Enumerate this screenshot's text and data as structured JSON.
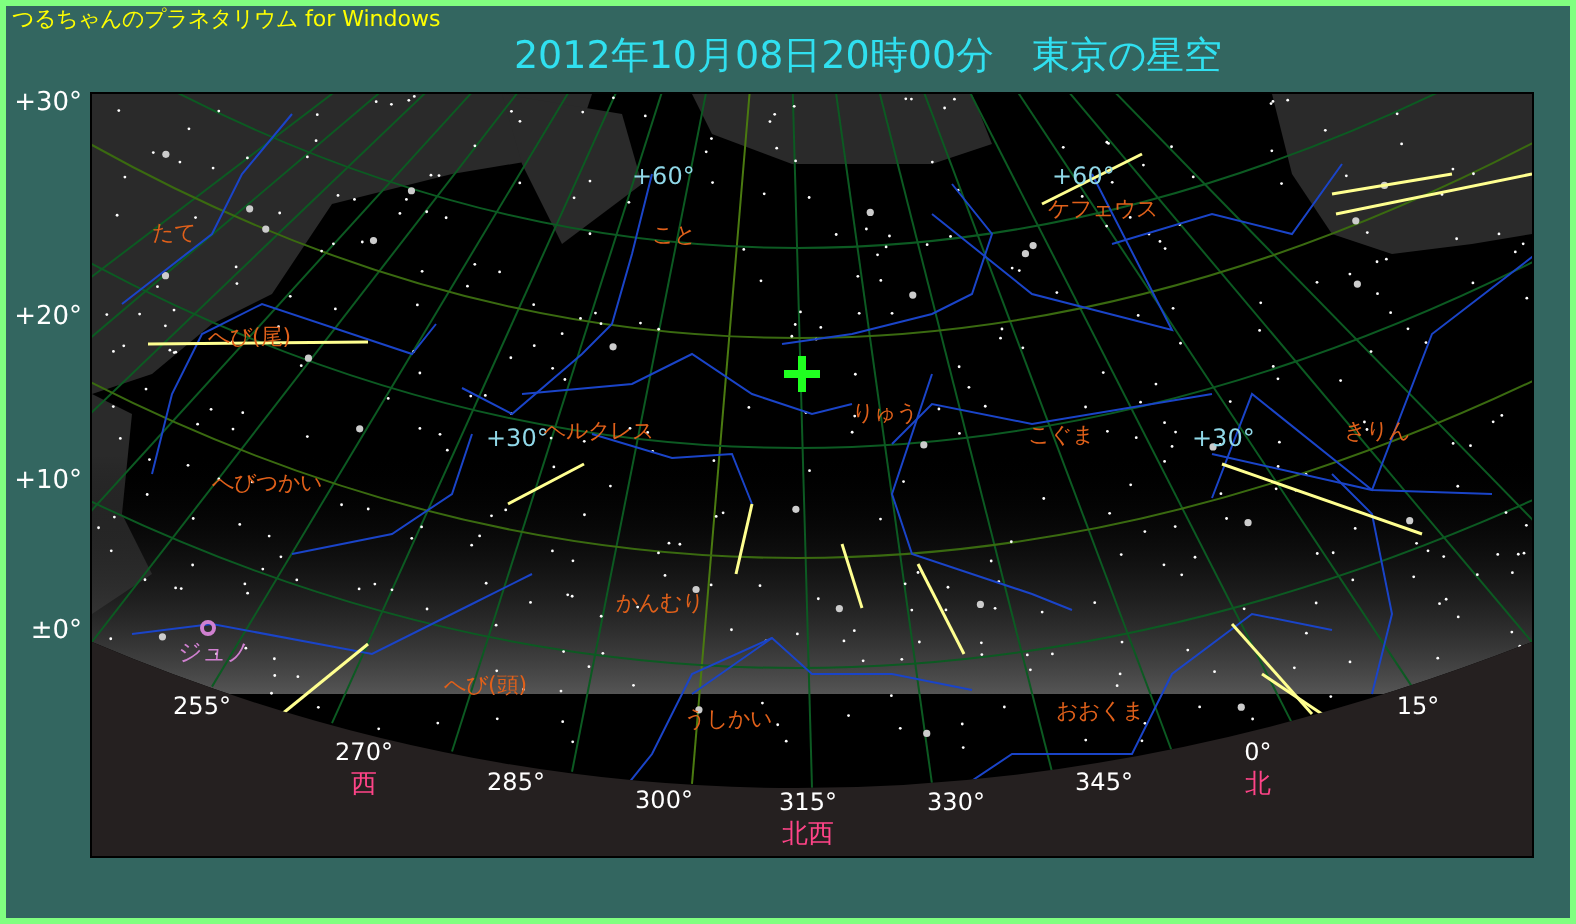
{
  "app_title": "つるちゃんのプラネタリウム for Windows",
  "heading": "2012年10月08日20時00分　東京の星空",
  "altitude_labels": [
    "+30°",
    "+20°",
    "+10°",
    "±0°"
  ],
  "sky_chart": {
    "grid_labels": [
      "+60°",
      "+60°",
      "+30°",
      "+30°"
    ],
    "constellations": [
      "たて",
      "こと",
      "ケフェウス",
      "へび(尾)",
      "ヘルクレス",
      "りゅう",
      "こぐま",
      "きりん",
      "へびつかい",
      "かんむり",
      "へび(頭)",
      "うしかい",
      "おおくま"
    ],
    "planets": [
      {
        "name": "ジュノ"
      }
    ],
    "azimuth_labels": [
      "255°",
      "270°",
      "285°",
      "300°",
      "315°",
      "330°",
      "345°",
      "0°",
      "15°"
    ],
    "direction_labels": [
      "西",
      "北西",
      "北"
    ]
  }
}
